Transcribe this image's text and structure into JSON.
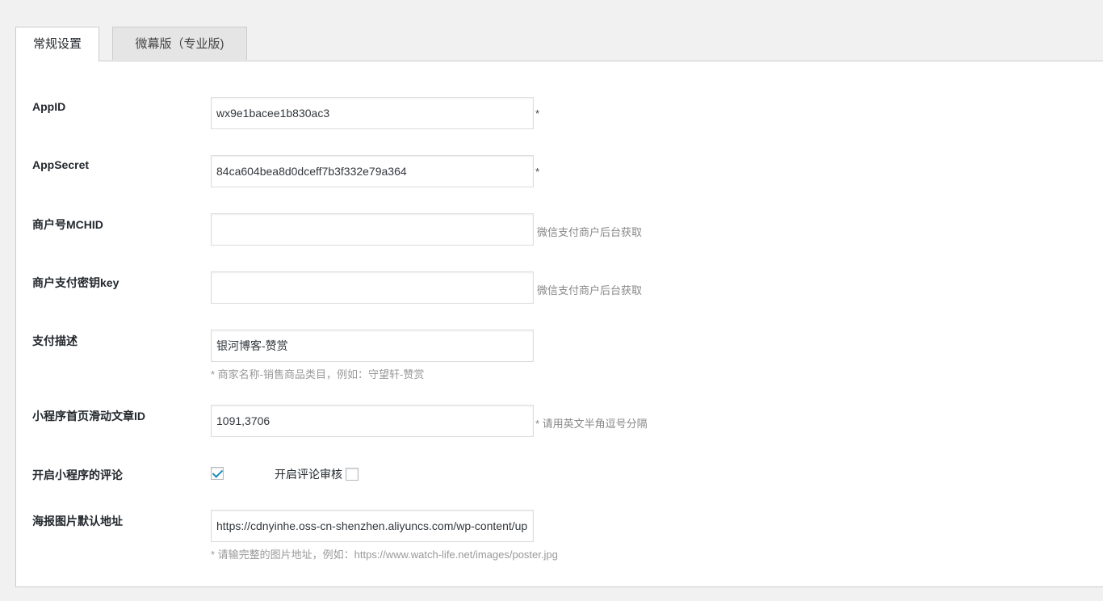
{
  "tabs": [
    {
      "label": "常规设置",
      "active": true
    },
    {
      "label": "微幕版（专业版)",
      "active": false
    }
  ],
  "fields": {
    "appid": {
      "label": "AppID",
      "value": "wx9e1bacee1b830ac3",
      "suffix": "*"
    },
    "appsecret": {
      "label": "AppSecret",
      "value": "84ca604bea8d0dceff7b3f332e79a364",
      "suffix": "*"
    },
    "mchid": {
      "label": "商户号MCHID",
      "value": "",
      "suffix": "微信支付商户后台获取"
    },
    "paykey": {
      "label": "商户支付密钥key",
      "value": "",
      "suffix": "微信支付商户后台获取"
    },
    "paydesc": {
      "label": "支付描述",
      "value": "银河博客-赞赏",
      "hint": "* 商家名称-销售商品类目，例如：守望轩-赞赏"
    },
    "sliderids": {
      "label": "小程序首页滑动文章ID",
      "value": "1091,3706",
      "suffix": "* 请用英文半角逗号分隔"
    },
    "comments": {
      "label": "开启小程序的评论",
      "checked": true,
      "review_label": "开启评论审核",
      "review_checked": false
    },
    "poster": {
      "label": "海报图片默认地址",
      "value": "https://cdnyinhe.oss-cn-shenzhen.aliyuncs.com/wp-content/up",
      "hint": "* 请输完整的图片地址，例如：https://www.watch-life.net/images/poster.jpg"
    }
  }
}
